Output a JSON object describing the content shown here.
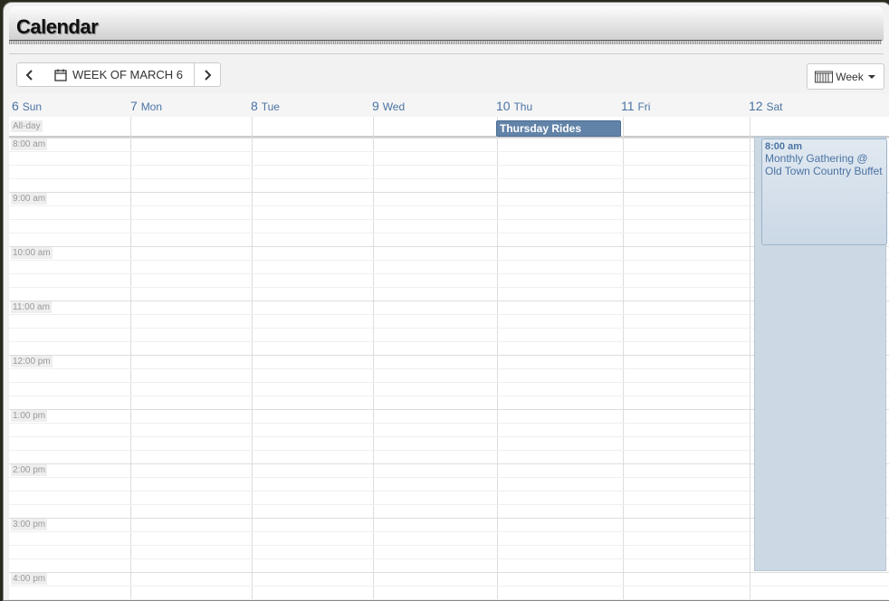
{
  "app": {
    "title": "Calendar"
  },
  "toolbar": {
    "prev_icon": "chevron-left-icon",
    "next_icon": "chevron-right-icon",
    "calendar_icon": "calendar-icon",
    "week_label": "WEEK OF MARCH 6",
    "view_label": "Week",
    "view_icon": "grid-icon"
  },
  "days": [
    {
      "num": "6",
      "name": "Sun"
    },
    {
      "num": "7",
      "name": "Mon"
    },
    {
      "num": "8",
      "name": "Tue"
    },
    {
      "num": "9",
      "name": "Wed"
    },
    {
      "num": "10",
      "name": "Thu"
    },
    {
      "num": "11",
      "name": "Fri"
    },
    {
      "num": "12",
      "name": "Sat"
    }
  ],
  "allday_label": "All-day",
  "times": [
    "8:00 am",
    "9:00 am",
    "10:00 am",
    "11:00 am",
    "12:00 pm",
    "1:00 pm",
    "2:00 pm",
    "3:00 pm",
    "4:00 pm"
  ],
  "events": {
    "allday": {
      "title": "Thursday Rides",
      "day": "Thu"
    },
    "timed": {
      "time": "8:00 am",
      "title": "Monthly Gathering @ Old Town Country Buffet",
      "day": "Sat"
    }
  },
  "colors": {
    "accent": "#4a73a3",
    "event_bg": "#6283a8",
    "sat_bg": "#ccd9e5"
  }
}
